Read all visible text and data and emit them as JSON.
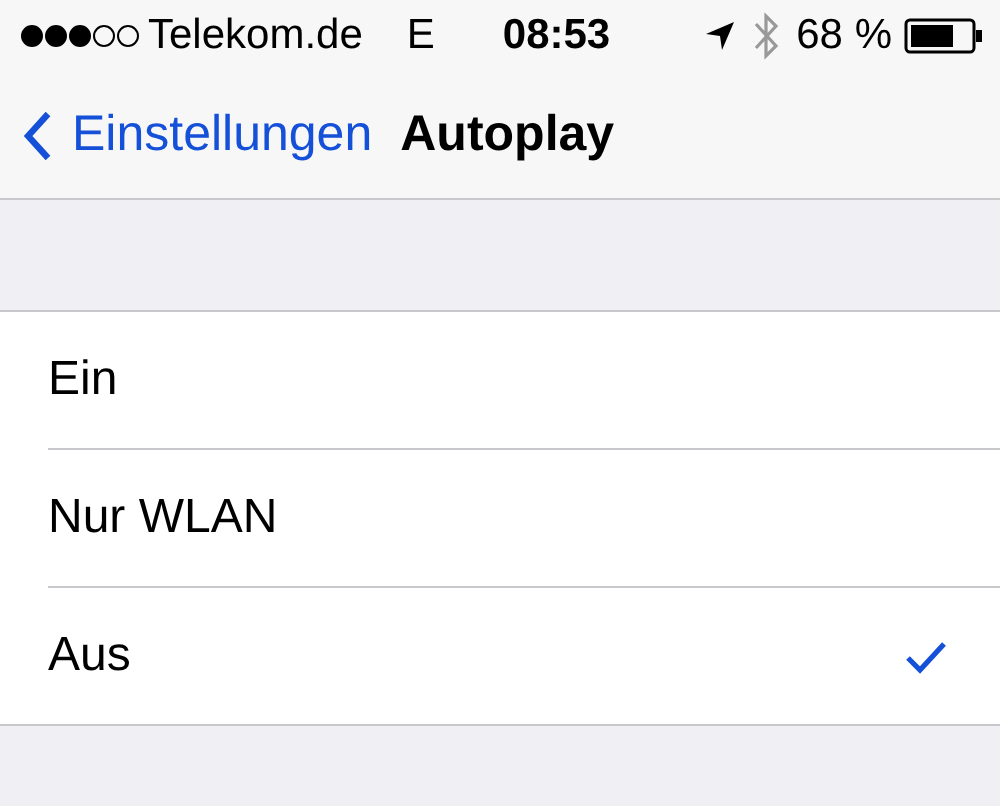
{
  "status_bar": {
    "carrier": "Telekom.de",
    "network": "E",
    "time": "08:53",
    "battery": "68 %"
  },
  "nav": {
    "back": "Einstellungen",
    "title": "Autoplay"
  },
  "options": [
    {
      "label": "Ein",
      "selected": false
    },
    {
      "label": "Nur WLAN",
      "selected": false
    },
    {
      "label": "Aus",
      "selected": true
    }
  ]
}
